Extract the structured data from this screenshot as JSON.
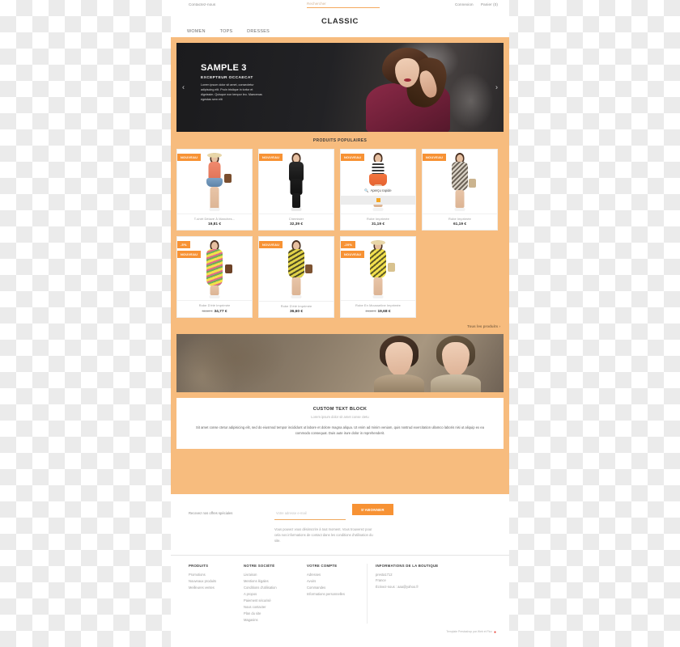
{
  "topbar": {
    "contact": "Contactez-nous",
    "search_placeholder": "Rechercher",
    "search_value": "",
    "login": "Connexion",
    "cart": "Panier (0)"
  },
  "header": {
    "logo": "CLASSIC",
    "nav": [
      {
        "label": "WOMEN"
      },
      {
        "label": "TOPS"
      },
      {
        "label": "DRESSES"
      }
    ]
  },
  "hero": {
    "title": "SAMPLE 3",
    "subtitle": "EXCEPTEUR OCCAECAT",
    "text": "Lorem ipsum dolor sit amet, consectetur adipiscing elit. Proin tristique in tortor et dignissim. Quisque non tempor leo. Maecenas egestas sem elit",
    "prev_icon": "chevron-left-icon",
    "next_icon": "chevron-right-icon"
  },
  "products_section": {
    "title": "PRODUITS POPULAIRES",
    "all_products_link": "Tous les produits",
    "quickview_label": "Aperçu rapide",
    "new_flag": "NOUVEAU",
    "items": [
      {
        "name": "T-shirt Délavé À Manches...",
        "price": "19,81 €",
        "old_price": "",
        "discount_flag": "",
        "new_flag": "NOUVEAU",
        "quickview": false
      },
      {
        "name": "Chemisier",
        "price": "32,39 €",
        "old_price": "",
        "discount_flag": "",
        "new_flag": "NOUVEAU",
        "quickview": false
      },
      {
        "name": "Robe Imprimée",
        "price": "31,19 €",
        "old_price": "",
        "discount_flag": "",
        "new_flag": "NOUVEAU",
        "quickview": true
      },
      {
        "name": "Robe Imprimée",
        "price": "61,19 €",
        "old_price": "",
        "discount_flag": "",
        "new_flag": "NOUVEAU",
        "quickview": false
      },
      {
        "name": "Robe D'été Imprimée",
        "price": "34,77 €",
        "old_price": "36,60 €",
        "discount_flag": "-5%",
        "new_flag": "NOUVEAU",
        "quickview": false
      },
      {
        "name": "Robe D'été Imprimée",
        "price": "36,60 €",
        "old_price": "",
        "discount_flag": "",
        "new_flag": "NOUVEAU",
        "quickview": false
      },
      {
        "name": "Robe En Mousseline Imprimée",
        "price": "19,68 €",
        "old_price": "24,60 €",
        "discount_flag": "-20%",
        "new_flag": "NOUVEAU",
        "quickview": false
      }
    ]
  },
  "custom_text_block": {
    "title": "CUSTOM TEXT BLOCK",
    "subtitle": "Lorem ipsum dolor sit amet conse ctetu",
    "body": "Sit amet conse ctetur adipisicing elit, sed do eiusmod tempor incididunt ut labore et dolore magna aliqua. Ut enim ad minim veniam, quis nostrud exercitation ullamco laboris nisi ut aliquip ex ea commodo consequat. Duis aute irure dolor in reprehenderit."
  },
  "newsletter": {
    "label": "Recevez nos offres spéciales",
    "email_placeholder": "Votre adresse e-mail",
    "email_value": "",
    "button": "S'ABONNER",
    "note": "Vous pouvez vous désinscrire à tout moment. Vous trouverez pour cela nos informations de contact dans les conditions d'utilisation du site."
  },
  "footer": {
    "columns": [
      {
        "heading": "PRODUITS",
        "links": [
          "Promotions",
          "Nouveaux produits",
          "Meilleures ventes"
        ]
      },
      {
        "heading": "NOTRE SOCIÉTÉ",
        "links": [
          "Livraison",
          "Mentions légales",
          "Conditions d'utilisation",
          "A propos",
          "Paiement sécurisé",
          "Nous contacter",
          "Plan du site",
          "Magasins"
        ]
      },
      {
        "heading": "VOTRE COMPTE",
        "links": [
          "Adresses",
          "Avoirs",
          "Commandes",
          "Informations personnelles"
        ]
      }
    ],
    "store_info": {
      "heading": "INFORMATIONS DE LA BOUTIQUE",
      "lines": [
        "presta1712",
        "France",
        "Écrivez-nous : aaa@yahoo.fr"
      ]
    },
    "credit": "Template Prestashop par Web et Flux"
  },
  "colors": {
    "accent": "#f79234",
    "body_bg": "#f7bc7e",
    "text_dark": "#2f2f2f",
    "text_muted": "#9a9a9a"
  }
}
